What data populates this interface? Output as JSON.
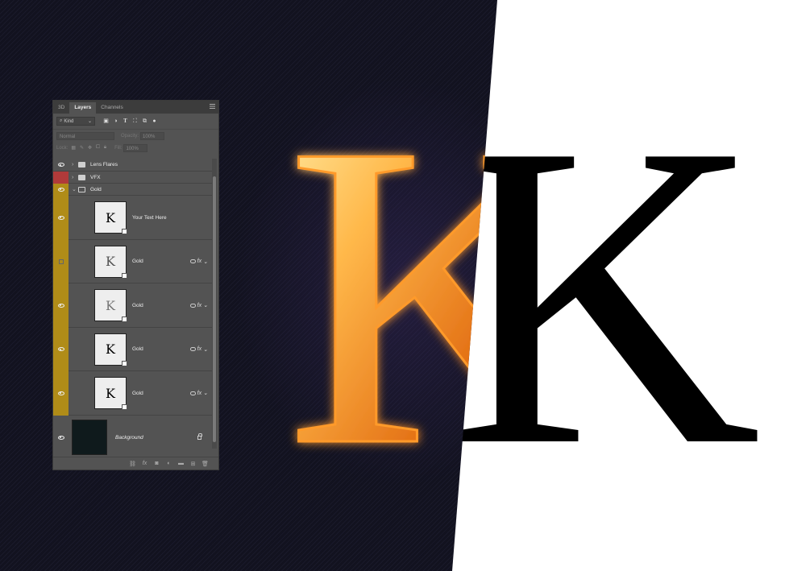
{
  "canvas": {
    "letter": "K",
    "left_background": "#12121f",
    "right_background": "#ffffff"
  },
  "panel": {
    "tabs": [
      {
        "label": "3D",
        "active": false
      },
      {
        "label": "Layers",
        "active": true
      },
      {
        "label": "Channels",
        "active": false
      }
    ],
    "filter": {
      "kind_label": "Kind"
    },
    "blend_mode": "Normal",
    "opacity_label": "Opacity:",
    "opacity_value": "100%",
    "lock_label": "Lock:",
    "fill_label": "Fill:",
    "fill_value": "100%",
    "layers": [
      {
        "name": "Lens Flares",
        "type": "group",
        "visible": true,
        "expanded": false,
        "color_tag": null
      },
      {
        "name": "VFX",
        "type": "group",
        "visible": false,
        "expanded": false,
        "color_tag": "#b03a3a"
      },
      {
        "name": "Gold",
        "type": "group",
        "visible": true,
        "expanded": true,
        "color_tag": "#b08c18"
      },
      {
        "name": "Your Text Here",
        "type": "smart",
        "visible": true,
        "thumb": "K",
        "fx": false,
        "color_tag": "#b08c18"
      },
      {
        "name": "Gold",
        "type": "smart",
        "visible": false,
        "thumb": "K",
        "fx": true,
        "fx_label": "fx",
        "color_tag": "#b08c18"
      },
      {
        "name": "Gold",
        "type": "smart",
        "visible": true,
        "thumb": "K",
        "fx": true,
        "fx_label": "fx",
        "color_tag": "#b08c18"
      },
      {
        "name": "Gold",
        "type": "smart",
        "visible": true,
        "thumb": "K",
        "fx": true,
        "fx_label": "fx",
        "color_tag": "#b08c18"
      },
      {
        "name": "Gold",
        "type": "smart",
        "visible": true,
        "thumb": "K",
        "fx": true,
        "fx_label": "fx",
        "color_tag": "#b08c18"
      },
      {
        "name": "Background",
        "type": "background",
        "visible": true,
        "locked": true,
        "color_tag": null
      }
    ],
    "footer_icons": [
      "link-icon",
      "fx-icon",
      "mask-icon",
      "adjustment-icon",
      "new-group-icon",
      "new-layer-icon",
      "trash-icon"
    ],
    "footer_fx_label": "fx"
  },
  "colors": {
    "gold_tag": "#b08c18",
    "red_tag": "#b03a3a",
    "panel_bg": "#535353"
  }
}
